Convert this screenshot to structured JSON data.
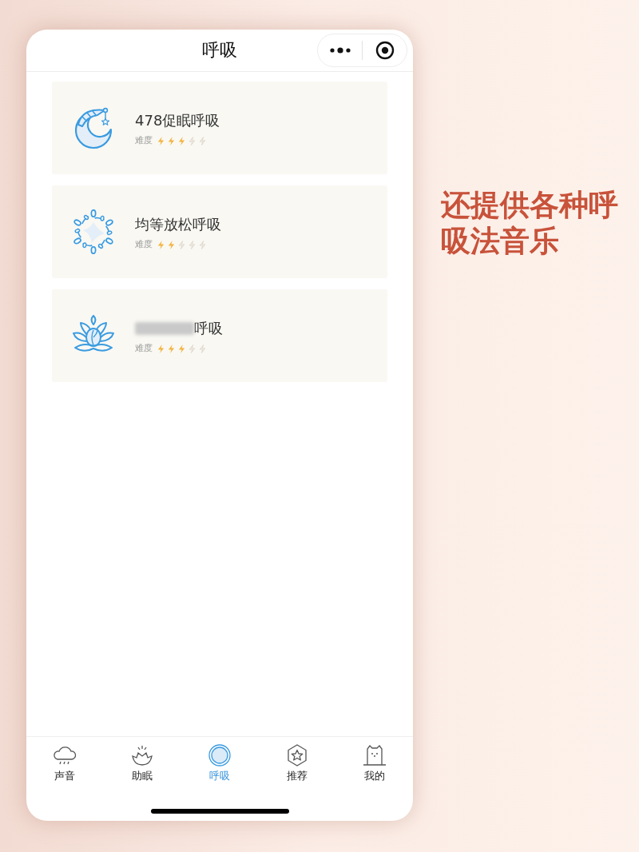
{
  "header": {
    "title": "呼吸"
  },
  "exercises": [
    {
      "title": "478促眠呼吸",
      "blurred_prefix": false,
      "difficulty_label": "难度",
      "stars": 3
    },
    {
      "title": "均等放松呼吸",
      "blurred_prefix": false,
      "difficulty_label": "难度",
      "stars": 2
    },
    {
      "title": "呼吸",
      "blurred_prefix": true,
      "difficulty_label": "难度",
      "stars": 3
    }
  ],
  "tab_bar": [
    {
      "label": "声音",
      "selected": false
    },
    {
      "label": "助眠",
      "selected": false
    },
    {
      "label": "呼吸",
      "selected": true
    },
    {
      "label": "推荐",
      "selected": false
    },
    {
      "label": "我的",
      "selected": false
    }
  ],
  "caption": "还提供各种呼吸法音乐"
}
